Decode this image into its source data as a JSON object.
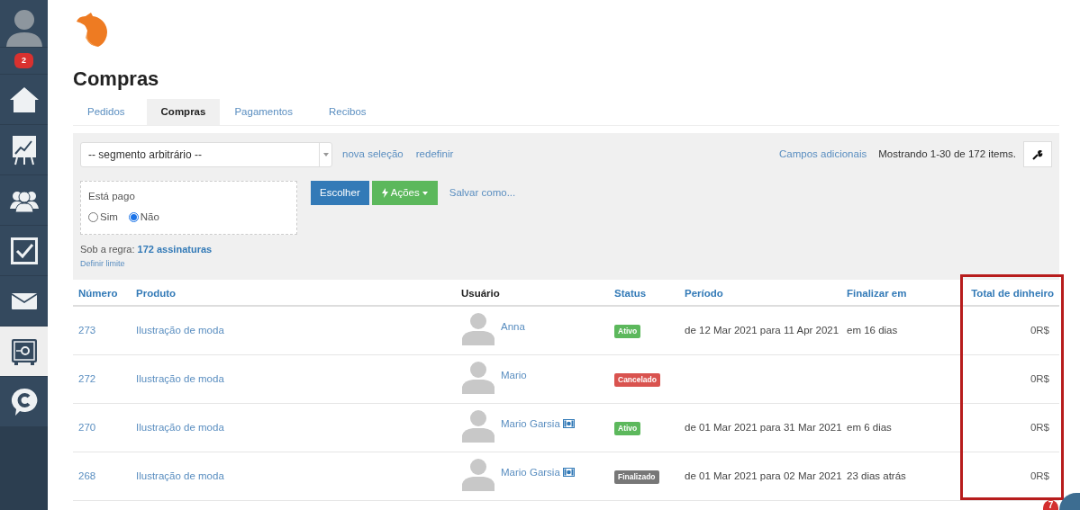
{
  "sidebar": {
    "notification_badge": "2",
    "items": [
      {
        "kind": "home",
        "selected": false
      },
      {
        "kind": "chart",
        "selected": false
      },
      {
        "kind": "people",
        "selected": false
      },
      {
        "kind": "tasks",
        "selected": false
      },
      {
        "kind": "mail",
        "selected": false
      },
      {
        "kind": "safe",
        "selected": true
      },
      {
        "kind": "chat",
        "selected": false
      }
    ]
  },
  "page_title": "Compras",
  "tabs": [
    {
      "label": "Pedidos",
      "selected": false
    },
    {
      "label": "Compras",
      "selected": true
    },
    {
      "label": "Pagamentos",
      "selected": false
    },
    {
      "label": "Recibos",
      "selected": false
    }
  ],
  "filter": {
    "segment_select": "-- segmento arbitrário --",
    "links": [
      "nova seleção",
      "redefinir"
    ],
    "additional_fields": "Campos adicionais",
    "showing": "Mostrando 1-30 de 172 items.",
    "condition": {
      "label": "Está pago",
      "options": [
        {
          "label": "Sim",
          "selected": false
        },
        {
          "label": "Não",
          "selected": true
        }
      ]
    },
    "buttons": [
      {
        "kind": "primary",
        "label": "Escolher"
      },
      {
        "kind": "actions",
        "label": "Ações"
      }
    ],
    "save_as": "Salvar como...",
    "rule_text": "Sob a regra: **172 assinaturas**",
    "set_limit": "Definir limite"
  },
  "table": {
    "columns": [
      "Número",
      "Produto",
      "Usuário",
      "Status",
      "Período",
      "Finalizar em",
      "Total de dinheiro"
    ],
    "rows": [
      {
        "number": "273",
        "product": "Ilustração de moda",
        "user": "Anna",
        "payment_icon": false,
        "status": {
          "label": "Ativo",
          "kind": "active"
        },
        "period": "de 12 Mar 2021 para 11 Apr 2021",
        "ends": "em 16 dias",
        "total": "0R$"
      },
      {
        "number": "272",
        "product": "Ilustração de moda",
        "user": "Mario",
        "payment_icon": false,
        "status": {
          "label": "Cancelado",
          "kind": "cancelled"
        },
        "period": "",
        "ends": "",
        "total": "0R$"
      },
      {
        "number": "270",
        "product": "Ilustração de moda",
        "user": "Mario Garsia",
        "payment_icon": true,
        "status": {
          "label": "Ativo",
          "kind": "active"
        },
        "period": "de 01 Mar 2021 para 31 Mar 2021",
        "ends": "em 6 dias",
        "total": "0R$"
      },
      {
        "number": "268",
        "product": "Ilustração de moda",
        "user": "Mario Garsia",
        "payment_icon": true,
        "status": {
          "label": "Finalizado",
          "kind": "finished"
        },
        "period": "de 01 Mar 2021 para 02 Mar 2021",
        "ends": "23 dias atrás",
        "total": "0R$"
      }
    ]
  },
  "chat_badge": "7"
}
